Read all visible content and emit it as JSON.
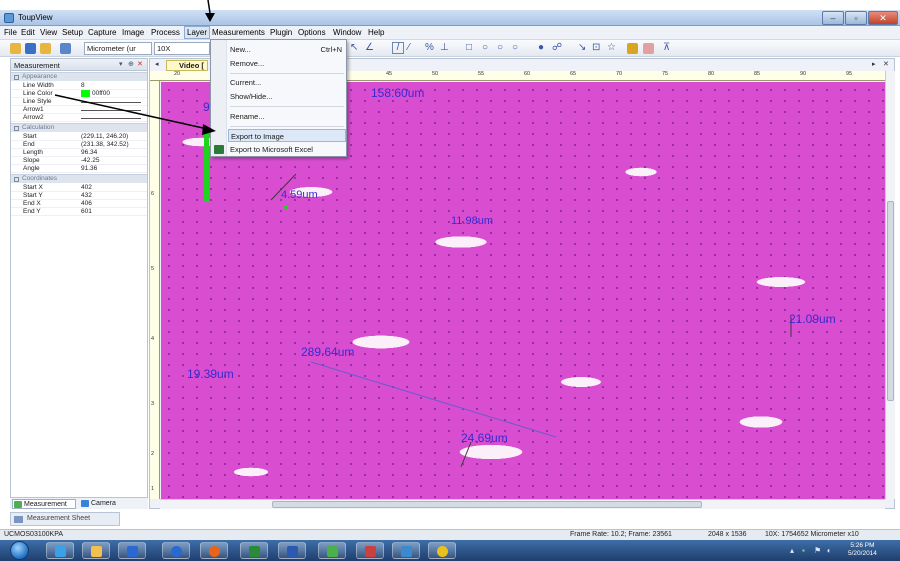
{
  "window": {
    "title": "ToupView",
    "min": "–",
    "max": "▫",
    "close": "✕"
  },
  "menu": [
    "File",
    "Edit",
    "View",
    "Setup",
    "Capture",
    "Image",
    "Process",
    "Layer",
    "Measurements",
    "Plugin",
    "Options",
    "Window",
    "Help"
  ],
  "menu_active": "Layer",
  "toolbar": {
    "unit_select": "Micrometer (ur",
    "magnification_select": "10X"
  },
  "left_panel": {
    "title": "Measurement",
    "groups": {
      "appearance": "Appearance",
      "calculation": "Calculation",
      "coordinates": "Coordinates"
    },
    "appearance_rows": [
      {
        "key": "Line Width",
        "value": "8"
      },
      {
        "key": "Line Color",
        "value": "00ff00"
      },
      {
        "key": "Line Style",
        "value": ""
      },
      {
        "key": "Arrow1",
        "value": ""
      },
      {
        "key": "Arrow2",
        "value": ""
      }
    ],
    "calculation_rows": [
      {
        "key": "Start",
        "value": "(229.11, 246.20)"
      },
      {
        "key": "End",
        "value": "(231.38, 342.52)"
      },
      {
        "key": "Length",
        "value": "96.34"
      },
      {
        "key": "Slope",
        "value": "-42.25"
      },
      {
        "key": "Angle",
        "value": "91.36"
      }
    ],
    "coordinate_rows": [
      {
        "key": "Start X",
        "value": "402"
      },
      {
        "key": "Start Y",
        "value": "432"
      },
      {
        "key": "End X",
        "value": "406"
      },
      {
        "key": "End Y",
        "value": "601"
      }
    ],
    "tabs": [
      "Measurement",
      "Camera"
    ]
  },
  "sheet_tab": "Measurement Sheet",
  "document": {
    "tab": "Video [",
    "ruler_h": [
      "20",
      "40",
      "45",
      "50",
      "55",
      "60",
      "65",
      "70",
      "75",
      "80",
      "85",
      "90",
      "95"
    ],
    "ruler_v": [
      "6",
      "5",
      "4",
      "3",
      "2",
      "1"
    ],
    "measurements": [
      "158.60um",
      "4.59um",
      "11.98um",
      "21.09um",
      "289.64um",
      "19.39um",
      "24.69um",
      "9"
    ]
  },
  "layer_menu": {
    "items": [
      {
        "label": "New...",
        "shortcut": "Ctrl+N"
      },
      {
        "label": "Remove...",
        "shortcut": ""
      },
      {
        "label": "Current...",
        "shortcut": ""
      },
      {
        "label": "Show/Hide...",
        "shortcut": ""
      },
      {
        "label": "Rename...",
        "shortcut": ""
      },
      {
        "label": "Export to Image",
        "shortcut": ""
      },
      {
        "label": "Export to Microsoft Excel",
        "shortcut": ""
      }
    ]
  },
  "status": {
    "left": "UCMOS03100KPA",
    "frame": "Frame Rate: 10.2; Frame: 23561",
    "resolution": "2048 x 1536",
    "calibration": "10X: 1754652 Micrometer x10"
  },
  "taskbar": {
    "time": "5:26 PM",
    "date": "5/20/2014"
  },
  "colors": {
    "stain": "#d94ed0",
    "measure_text": "#3a2ad0",
    "line_color": "#00ff00"
  }
}
